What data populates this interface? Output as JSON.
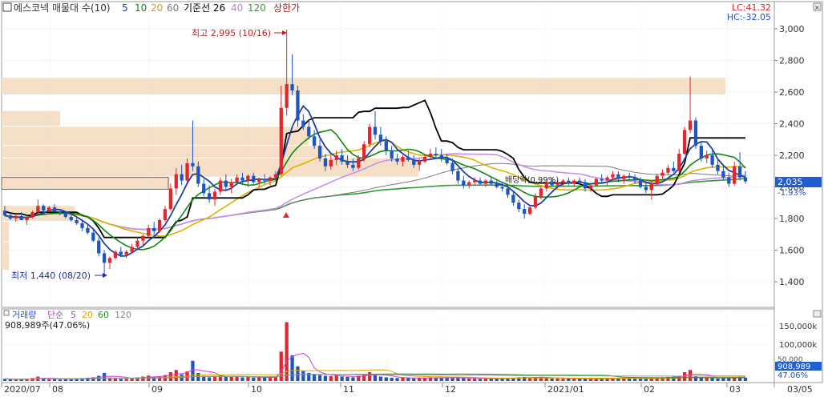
{
  "legend": {
    "title": "에스코넥 매물대 수(10)",
    "ma": [
      {
        "label": "5",
        "color": "#1f3f9f"
      },
      {
        "label": "10",
        "color": "#0f8a0f"
      },
      {
        "label": "20",
        "color": "#d9a400"
      },
      {
        "label": "60",
        "color": "#7a7a7a"
      },
      {
        "label": "기준선 26",
        "color": "#000000"
      },
      {
        "label": "40",
        "color": "#c080e0"
      },
      {
        "label": "120",
        "color": "#3a9a3a"
      },
      {
        "label": "상한가",
        "color": "#b22222"
      }
    ]
  },
  "header_right": {
    "lc": "LC:41.32",
    "hc": "HC:-32.05"
  },
  "annotations": {
    "high": "최고 2,995 (10/16)",
    "low": "최저 1,440 (08/20)",
    "mid": "배당락(0.99%)"
  },
  "price_label": {
    "value": "2,035",
    "change": "-1.93%"
  },
  "volume_legend": {
    "title": "거래량",
    "ma_label": "단순",
    "periods": [
      "5",
      "20",
      "60",
      "120"
    ],
    "current": "908,989주(47.06%)"
  },
  "volume_label": {
    "value": "908,989",
    "pct": "47.06%",
    "above": "50,000"
  },
  "x_ticks": [
    "2020/07",
    "08",
    "09",
    "10",
    "11",
    "12",
    "2021/01",
    "02",
    "03",
    "03/05"
  ],
  "colors": {
    "up": "#e4262c",
    "down": "#1f55c0",
    "volume_profile": "#f5dfc6",
    "price_box": "#1f5fd0"
  },
  "chart_data": {
    "type": "candlestick",
    "y_ticks": [
      "3,000",
      "2,800",
      "2,600",
      "2,400",
      "2,200",
      "2,000",
      "1,800",
      "1,600",
      "1,400"
    ],
    "ylim": [
      1400,
      3000
    ],
    "volume_ticks": [
      "150,000k",
      "100,000k",
      "50,000"
    ],
    "high": {
      "value": 2995,
      "date": "10/16"
    },
    "low": {
      "value": 1440,
      "date": "08/20"
    },
    "last": {
      "close": 2035,
      "change_pct": -1.93
    },
    "volume_profile_bands": [
      {
        "low": 2580,
        "high": 2690,
        "size": 0.99
      },
      {
        "low": 2380,
        "high": 2480,
        "size": 0.08
      },
      {
        "low": 2260,
        "high": 2380,
        "size": 0.42
      },
      {
        "low": 2180,
        "high": 2260,
        "size": 0.44
      },
      {
        "low": 2060,
        "high": 2180,
        "size": 0.57
      },
      {
        "low": 1980,
        "high": 2060,
        "size": 0.23
      },
      {
        "low": 1880,
        "high": 1980,
        "size": 0.0
      },
      {
        "low": 1780,
        "high": 1880,
        "size": 0.1
      },
      {
        "low": 1650,
        "high": 1780,
        "size": 0.01
      },
      {
        "low": 1470,
        "high": 1650,
        "size": 0.01
      }
    ],
    "candles": [
      [
        1850,
        1880,
        1810,
        1820
      ],
      [
        1820,
        1840,
        1790,
        1800
      ],
      [
        1800,
        1830,
        1780,
        1815
      ],
      [
        1815,
        1840,
        1800,
        1790
      ],
      [
        1790,
        1820,
        1760,
        1810
      ],
      [
        1810,
        1850,
        1800,
        1840
      ],
      [
        1840,
        1920,
        1830,
        1880
      ],
      [
        1880,
        1890,
        1840,
        1850
      ],
      [
        1850,
        1880,
        1830,
        1870
      ],
      [
        1870,
        1890,
        1840,
        1845
      ],
      [
        1845,
        1860,
        1820,
        1835
      ],
      [
        1835,
        1850,
        1800,
        1810
      ],
      [
        1810,
        1830,
        1780,
        1790
      ],
      [
        1790,
        1810,
        1760,
        1770
      ],
      [
        1770,
        1790,
        1720,
        1740
      ],
      [
        1740,
        1760,
        1700,
        1710
      ],
      [
        1710,
        1730,
        1650,
        1660
      ],
      [
        1660,
        1680,
        1560,
        1580
      ],
      [
        1580,
        1600,
        1440,
        1520
      ],
      [
        1520,
        1560,
        1480,
        1550
      ],
      [
        1550,
        1600,
        1540,
        1590
      ],
      [
        1590,
        1620,
        1560,
        1570
      ],
      [
        1570,
        1600,
        1550,
        1590
      ],
      [
        1590,
        1640,
        1580,
        1620
      ],
      [
        1620,
        1680,
        1600,
        1660
      ],
      [
        1660,
        1700,
        1630,
        1690
      ],
      [
        1690,
        1760,
        1680,
        1740
      ],
      [
        1740,
        1780,
        1700,
        1720
      ],
      [
        1720,
        1800,
        1710,
        1790
      ],
      [
        1790,
        1880,
        1780,
        1860
      ],
      [
        1860,
        2020,
        1850,
        1990
      ],
      [
        1990,
        2120,
        1950,
        2080
      ],
      [
        2080,
        2140,
        2010,
        2040
      ],
      [
        2040,
        2180,
        2030,
        2150
      ],
      [
        2150,
        2420,
        2100,
        2130
      ],
      [
        2130,
        2160,
        2000,
        2020
      ],
      [
        2020,
        2050,
        1940,
        1960
      ],
      [
        1960,
        2010,
        1900,
        1920
      ],
      [
        1920,
        1990,
        1880,
        1970
      ],
      [
        1970,
        2060,
        1950,
        2040
      ],
      [
        2040,
        2080,
        1980,
        2000
      ],
      [
        2000,
        2050,
        1960,
        2030
      ],
      [
        2030,
        2080,
        2010,
        2060
      ],
      [
        2060,
        2090,
        2020,
        2040
      ],
      [
        2040,
        2080,
        2000,
        2070
      ],
      [
        2070,
        2090,
        2020,
        2030
      ],
      [
        2030,
        2060,
        2000,
        2050
      ],
      [
        2050,
        2080,
        2020,
        2040
      ],
      [
        2040,
        2070,
        2010,
        2060
      ],
      [
        2060,
        2100,
        2040,
        2080
      ],
      [
        2080,
        2640,
        2070,
        2500
      ],
      [
        2500,
        2995,
        2450,
        2650
      ],
      [
        2650,
        2840,
        2580,
        2610
      ],
      [
        2610,
        2640,
        2380,
        2420
      ],
      [
        2420,
        2460,
        2360,
        2380
      ],
      [
        2380,
        2430,
        2300,
        2320
      ],
      [
        2320,
        2360,
        2240,
        2260
      ],
      [
        2260,
        2300,
        2160,
        2180
      ],
      [
        2180,
        2210,
        2100,
        2130
      ],
      [
        2130,
        2200,
        2110,
        2170
      ],
      [
        2170,
        2230,
        2140,
        2200
      ],
      [
        2200,
        2240,
        2140,
        2160
      ],
      [
        2160,
        2200,
        2120,
        2140
      ],
      [
        2140,
        2180,
        2100,
        2120
      ],
      [
        2120,
        2200,
        2110,
        2180
      ],
      [
        2180,
        2290,
        2160,
        2270
      ],
      [
        2270,
        2400,
        2250,
        2380
      ],
      [
        2380,
        2480,
        2300,
        2330
      ],
      [
        2330,
        2380,
        2260,
        2290
      ],
      [
        2290,
        2320,
        2200,
        2230
      ],
      [
        2230,
        2260,
        2160,
        2180
      ],
      [
        2180,
        2210,
        2140,
        2160
      ],
      [
        2160,
        2200,
        2130,
        2190
      ],
      [
        2190,
        2230,
        2160,
        2170
      ],
      [
        2170,
        2200,
        2120,
        2140
      ],
      [
        2140,
        2180,
        2100,
        2160
      ],
      [
        2160,
        2210,
        2150,
        2190
      ],
      [
        2190,
        2240,
        2170,
        2210
      ],
      [
        2210,
        2250,
        2180,
        2200
      ],
      [
        2200,
        2240,
        2160,
        2180
      ],
      [
        2180,
        2210,
        2140,
        2150
      ],
      [
        2150,
        2180,
        2080,
        2100
      ],
      [
        2100,
        2120,
        2020,
        2040
      ],
      [
        2040,
        2070,
        1990,
        2010
      ],
      [
        2010,
        2040,
        1990,
        2030
      ],
      [
        2030,
        2060,
        2010,
        2040
      ],
      [
        2040,
        2060,
        2010,
        2020
      ],
      [
        2020,
        2050,
        2000,
        2040
      ],
      [
        2040,
        2060,
        2010,
        2020
      ],
      [
        2020,
        2040,
        1990,
        2000
      ],
      [
        2000,
        2030,
        1970,
        1990
      ],
      [
        1990,
        2010,
        1930,
        1950
      ],
      [
        1950,
        1970,
        1880,
        1900
      ],
      [
        1900,
        1920,
        1840,
        1860
      ],
      [
        1860,
        1890,
        1800,
        1830
      ],
      [
        1830,
        1880,
        1820,
        1870
      ],
      [
        1870,
        1960,
        1860,
        1940
      ],
      [
        1940,
        2000,
        1920,
        1990
      ],
      [
        1990,
        2040,
        1970,
        2030
      ],
      [
        2030,
        2060,
        2000,
        2010
      ],
      [
        2010,
        2040,
        1990,
        2030
      ],
      [
        2030,
        2050,
        2000,
        2040
      ],
      [
        2040,
        2060,
        2010,
        2020
      ],
      [
        2020,
        2050,
        2000,
        2040
      ],
      [
        2040,
        2060,
        2010,
        2030
      ],
      [
        2030,
        2050,
        1970,
        1990
      ],
      [
        1990,
        2020,
        1970,
        2010
      ],
      [
        2010,
        2060,
        2000,
        2050
      ],
      [
        2050,
        2080,
        2030,
        2040
      ],
      [
        2040,
        2070,
        2010,
        2060
      ],
      [
        2060,
        2100,
        2040,
        2080
      ],
      [
        2080,
        2100,
        2030,
        2050
      ],
      [
        2050,
        2080,
        2020,
        2070
      ],
      [
        2070,
        2090,
        2040,
        2060
      ],
      [
        2060,
        2080,
        2020,
        2040
      ],
      [
        2040,
        2060,
        1990,
        2000
      ],
      [
        2000,
        2030,
        1960,
        1980
      ],
      [
        1980,
        2040,
        1920,
        2020
      ],
      [
        2020,
        2080,
        2010,
        2070
      ],
      [
        2070,
        2110,
        2050,
        2090
      ],
      [
        2090,
        2140,
        2080,
        2120
      ],
      [
        2120,
        2160,
        2090,
        2100
      ],
      [
        2100,
        2240,
        2090,
        2210
      ],
      [
        2210,
        2380,
        2200,
        2360
      ],
      [
        2360,
        2700,
        2340,
        2420
      ],
      [
        2420,
        2440,
        2240,
        2260
      ],
      [
        2260,
        2280,
        2160,
        2180
      ],
      [
        2180,
        2230,
        2150,
        2200
      ],
      [
        2200,
        2230,
        2120,
        2140
      ],
      [
        2140,
        2170,
        2080,
        2100
      ],
      [
        2100,
        2130,
        2040,
        2060
      ],
      [
        2060,
        2090,
        2000,
        2020
      ],
      [
        2020,
        2160,
        2010,
        2130
      ],
      [
        2130,
        2220,
        2040,
        2060
      ],
      [
        2060,
        2100,
        2020,
        2035
      ]
    ],
    "volumes": [
      6,
      5,
      4,
      5,
      6,
      8,
      12,
      7,
      5,
      5,
      4,
      5,
      6,
      7,
      8,
      9,
      10,
      14,
      22,
      9,
      7,
      6,
      6,
      8,
      10,
      12,
      15,
      11,
      13,
      16,
      24,
      30,
      18,
      26,
      55,
      22,
      14,
      10,
      12,
      16,
      12,
      11,
      13,
      10,
      11,
      9,
      10,
      9,
      10,
      12,
      80,
      160,
      70,
      40,
      28,
      22,
      18,
      16,
      14,
      13,
      15,
      12,
      11,
      10,
      14,
      18,
      24,
      16,
      12,
      10,
      9,
      8,
      9,
      8,
      7,
      8,
      9,
      10,
      9,
      8,
      8,
      9,
      10,
      8,
      7,
      7,
      6,
      7,
      6,
      6,
      7,
      8,
      9,
      10,
      11,
      9,
      10,
      11,
      8,
      7,
      7,
      6,
      7,
      6,
      6,
      7,
      6,
      6,
      7,
      6,
      7,
      8,
      7,
      7,
      6,
      6,
      7,
      8,
      9,
      10,
      11,
      12,
      14,
      24,
      30,
      13,
      10,
      9,
      8,
      7,
      8,
      9,
      10,
      12,
      9,
      9
    ]
  }
}
